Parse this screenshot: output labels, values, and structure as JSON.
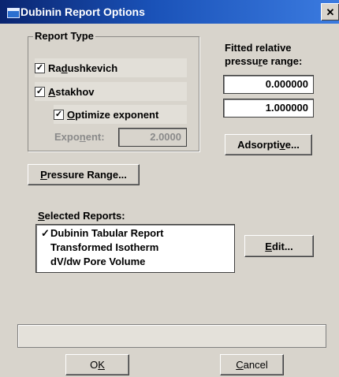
{
  "window": {
    "title": "Dubinin Report Options",
    "close_label": "✕"
  },
  "report_type": {
    "legend": "Report Type",
    "radushkevich": {
      "label_pre": "Ra",
      "label_key": "d",
      "label_post": "ushkevich",
      "checked": true
    },
    "astakhov": {
      "label_pre": "",
      "label_key": "A",
      "label_post": "stakhov",
      "checked": true
    },
    "optimize": {
      "label_pre": "",
      "label_key": "O",
      "label_post": "ptimize exponent",
      "checked": true
    },
    "exponent": {
      "label_pre": "Expo",
      "label_key": "n",
      "label_post": "ent:",
      "value": "2.0000"
    }
  },
  "pressure": {
    "label_line1": "Fitted relative",
    "label_line2_pre": "pressu",
    "label_line2_key": "r",
    "label_line2_post": "e range:",
    "from": "0.000000",
    "to": "1.000000"
  },
  "buttons": {
    "adsorptive_pre": "Adsorpti",
    "adsorptive_key": "v",
    "adsorptive_post": "e...",
    "pressure_range_pre": "",
    "pressure_range_key": "P",
    "pressure_range_post": "ressure Range...",
    "edit_pre": "",
    "edit_key": "E",
    "edit_post": "dit...",
    "ok_pre": "O",
    "ok_key": "K",
    "ok_post": "",
    "cancel_pre": "",
    "cancel_key": "C",
    "cancel_post": "ancel"
  },
  "selected_reports": {
    "label_pre": "",
    "label_key": "S",
    "label_post": "elected Reports:",
    "items": [
      {
        "label": "Dubinin Tabular Report",
        "checked": true,
        "check": "✓"
      },
      {
        "label": "Transformed Isotherm",
        "checked": false,
        "check": ""
      },
      {
        "label": "dV/dw Pore Volume",
        "checked": false,
        "check": ""
      }
    ]
  },
  "status": {
    "text": ""
  },
  "icons": {
    "app": "window-icon",
    "check": "checkmark"
  },
  "colors": {
    "title_start": "#0a2570",
    "title_end": "#3b7be0",
    "face": "#d8d4cc"
  }
}
